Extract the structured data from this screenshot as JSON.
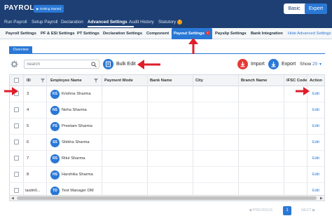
{
  "header": {
    "app_title": "PAYROLL",
    "getting_started": "▶ Getting Started",
    "mode_basic": "Basic",
    "mode_expert": "Expert",
    "menu": [
      "Run Payroll",
      "Setup Payroll",
      "Declaration",
      "Advanced Settings",
      "Audit History",
      "Statutory"
    ],
    "statutory_badge": "!"
  },
  "subtabs": {
    "items": [
      "Payroll Settings",
      "PF & ESI Settings",
      "PT Settings",
      "Declaration Settings",
      "Component",
      "Payout Settings",
      "Payslip Settings",
      "Bank Integration"
    ],
    "active_badge": "!",
    "hide_link": "Hide Advanced Settings"
  },
  "overview_tab": "Overview",
  "toolbar": {
    "search_placeholder": "Search",
    "bulk_edit": "Bulk Edit",
    "import": "Import",
    "export": "Export",
    "show_label": "Show",
    "show_value": "20"
  },
  "table": {
    "columns": [
      "ID",
      "Employee Name",
      "Payment Mode",
      "Bank Name",
      "City",
      "Branch Name",
      "IFSC Code",
      "Action"
    ],
    "rows": [
      {
        "id": "3",
        "initials": "KS",
        "name": "Krishna Sharma",
        "action": "Edit"
      },
      {
        "id": "4",
        "initials": "NS",
        "name": "Neha Sharma",
        "action": "Edit"
      },
      {
        "id": "5",
        "initials": "PS",
        "name": "Preetam Sharma",
        "action": "Edit"
      },
      {
        "id": "6",
        "initials": "SS",
        "name": "Shikha Sharma",
        "action": "Edit"
      },
      {
        "id": "7",
        "initials": "RS",
        "name": "Ritul Sharma",
        "action": "Edit"
      },
      {
        "id": "8",
        "initials": "HS",
        "name": "Harshika Sharma",
        "action": "Edit"
      },
      {
        "id": "tasdm0...",
        "initials": "TD",
        "name": "Test Manager DM",
        "action": "Edit"
      }
    ]
  },
  "pagination": {
    "previous": "◀ PREVIOUS",
    "page": "1",
    "next": "NEXT ▶"
  },
  "colors": {
    "header_bg": "#1d3f73",
    "accent": "#2a78d6",
    "annotation": "#e11d2a"
  }
}
